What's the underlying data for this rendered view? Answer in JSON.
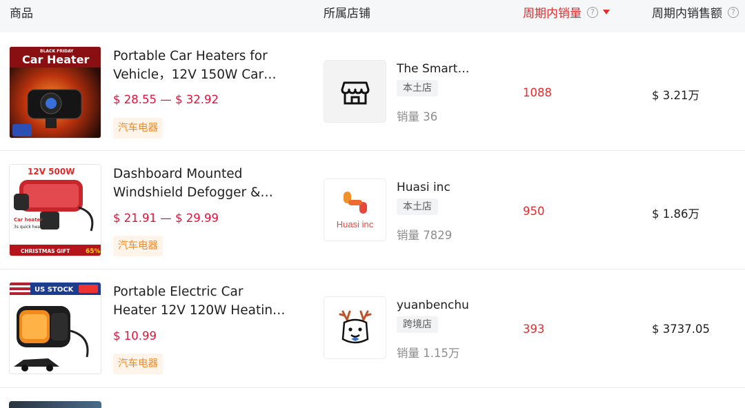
{
  "header": {
    "product": "商品",
    "shop": "所属店铺",
    "period_sales": "周期内销量",
    "period_revenue": "周期内销售额",
    "help_glyph": "?"
  },
  "colors": {
    "accent_red": "#e52b2b",
    "price_red": "#e4123a",
    "category_orange": "#f08a28"
  },
  "rows": [
    {
      "title_line1": "Portable Car Heaters for",
      "title_line2": "Vehicle，12V 150W Car…",
      "price": "$ 28.55 — $ 32.92",
      "category": "汽车电器",
      "thumb_text_top": "BLACK FRIDAY",
      "thumb_text_main": "Car Heater",
      "shop_name": "The Smart…",
      "shop_type": "本土店",
      "shop_sales": "销量 36",
      "shop_logo_icon": "storefront-icon",
      "sales": "1088",
      "amount": "$ 3.21万"
    },
    {
      "title_line1": "Dashboard Mounted",
      "title_line2": "Windshield Defogger &…",
      "price": "$ 21.91 — $ 29.99",
      "category": "汽车电器",
      "thumb_text_top": "12V  500W",
      "thumb_text_main": "Car heater",
      "thumb_text_sub": "3s quick heat",
      "thumb_text_bottom": "CHRISTMAS GIFT",
      "thumb_text_badge": "65%",
      "shop_name": "Huasi inc",
      "shop_type": "本土店",
      "shop_sales": "销量 7829",
      "shop_logo_text": "Huasi inc",
      "sales": "950",
      "amount": "$ 1.86万"
    },
    {
      "title_line1": "Portable Electric Car",
      "title_line2": "Heater 12V 120W Heatin…",
      "price": "$ 10.99",
      "category": "汽车电器",
      "thumb_text_top": "US STOCK",
      "shop_name": "yuanbenchu",
      "shop_type": "跨境店",
      "shop_sales": "销量 1.15万",
      "shop_logo_icon": "reindeer-mascot-icon",
      "sales": "393",
      "amount": "$ 3737.05"
    }
  ]
}
